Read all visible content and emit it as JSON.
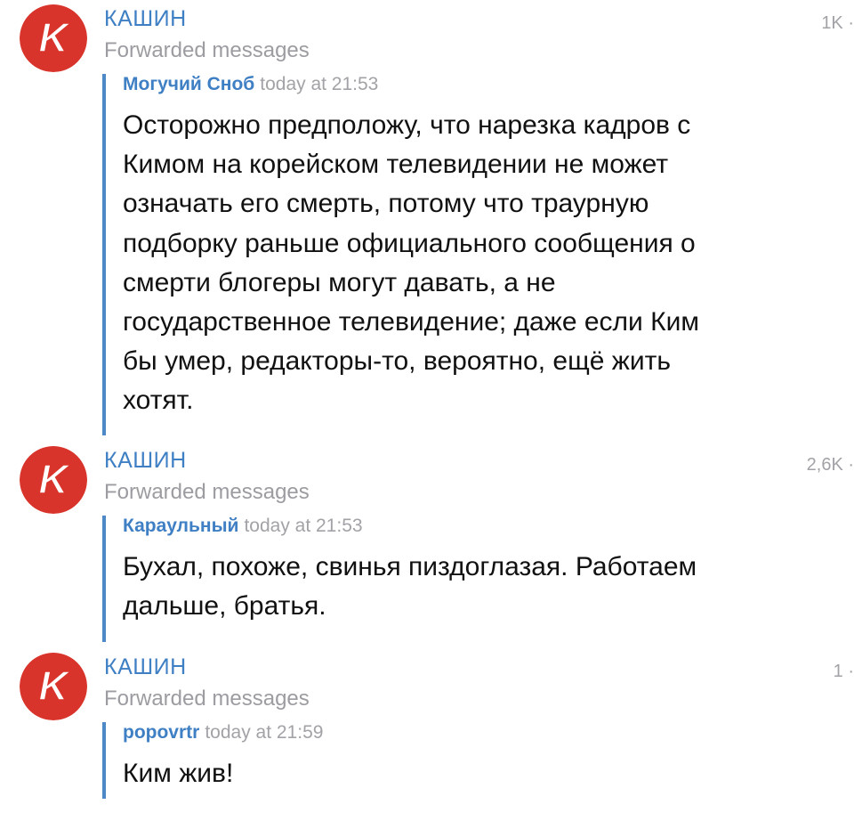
{
  "posts": [
    {
      "channel": "КАШИН",
      "views": "1K ·",
      "subtitle": "Forwarded messages",
      "avatar_letter": "K",
      "forward": {
        "author": "Могучий Сноб",
        "time": "today at 21:53",
        "text": "Осторожно предположу, что нарезка кадров с\nКимом на корейском телевидении не может\nозначать его смерть, потому что траурную\nподборку раньше официального сообщения о\nсмерти блогеры могут давать, а не\nгосударственное телевидение; даже если Ким\nбы умер, редакторы-то, вероятно, ещё жить\nхотят."
      }
    },
    {
      "channel": "КАШИН",
      "views": "2,6K ·",
      "subtitle": "Forwarded messages",
      "avatar_letter": "K",
      "forward": {
        "author": "Караульный",
        "time": "today at 21:53",
        "text": "Бухал, похоже, свинья пиздоглазая. Работаем\nдальше, братья."
      }
    },
    {
      "channel": "КАШИН",
      "views": "1 ·",
      "subtitle": "Forwarded messages",
      "avatar_letter": "K",
      "forward": {
        "author": "popovrtr",
        "time": "today at 21:59",
        "text": "Ким жив!"
      }
    }
  ],
  "colors": {
    "accent": "#3f7fc4",
    "avatar_red": "#d9342b",
    "secondary_text": "#9c9ca1"
  },
  "icons": {
    "avatar": "channel-logo-k-icon"
  }
}
